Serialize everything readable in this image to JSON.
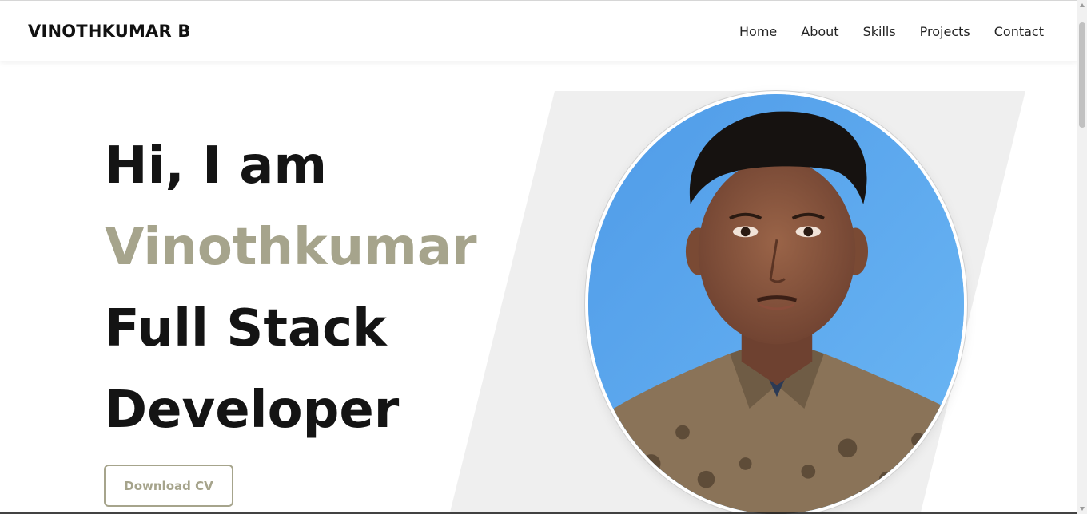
{
  "header": {
    "brand": "VINOTHKUMAR B",
    "nav": [
      "Home",
      "About",
      "Skills",
      "Projects",
      "Contact"
    ]
  },
  "hero": {
    "greeting": "Hi, I am",
    "name": "Vinothkumar",
    "role_line1": "Full Stack",
    "role_line2": "Developer",
    "cv_button": "Download CV"
  },
  "colors": {
    "accent": "#a6a48c",
    "panel": "#efefef",
    "photo_background": "#5ea9ec"
  },
  "icons": [
    "scroll-up-arrow-icon",
    "scroll-down-arrow-icon"
  ]
}
